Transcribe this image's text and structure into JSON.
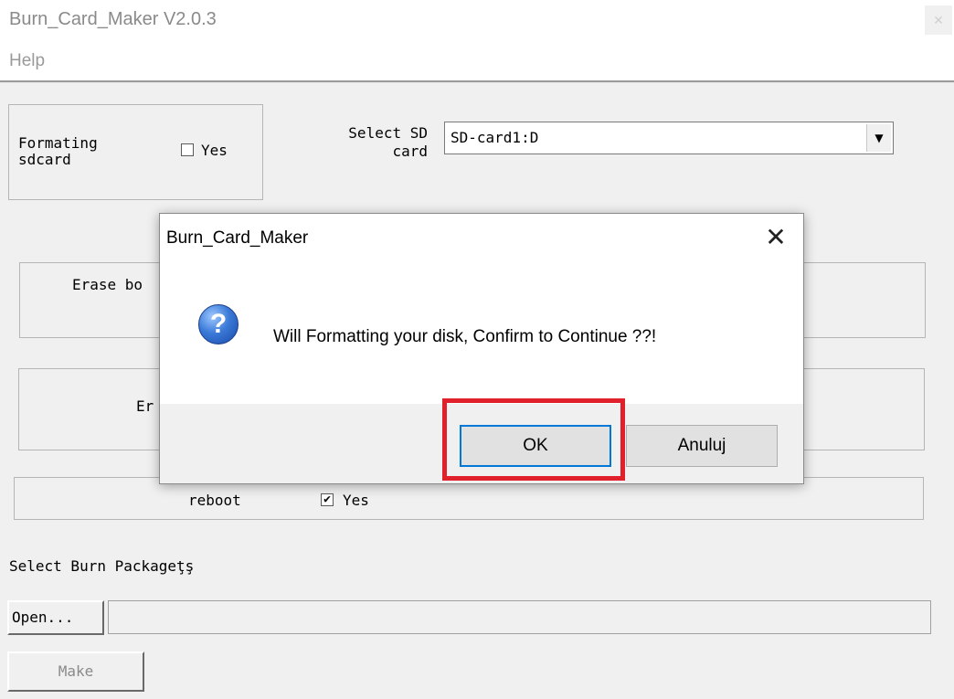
{
  "window": {
    "title": "Burn_Card_Maker V2.0.3",
    "close_icon": "close-icon"
  },
  "menu": {
    "help": "Help"
  },
  "format_group": {
    "label": "Formating\nsdcard",
    "checkbox_label": "Yes",
    "checked": false
  },
  "sd_select": {
    "label": "Select SD\ncard",
    "value": "SD-card1:D"
  },
  "erase_boot": {
    "label_partial": "Erase bo"
  },
  "erase_second": {
    "label_partial": "Er"
  },
  "reboot": {
    "label": "reboot",
    "checkbox_label": "Yes",
    "checked": true
  },
  "burn_packages": {
    "label": "Select Burn Packageţş",
    "open_button": "Open...",
    "path_value": ""
  },
  "make_button": "Make",
  "dialog": {
    "title": "Burn_Card_Maker",
    "close_glyph": "✕",
    "icon": "question-icon",
    "message": "Will Formatting your disk, Confirm to Continue ??!",
    "ok_label": "OK",
    "cancel_label": "Anuluj"
  },
  "annotation": {
    "highlight_color": "#e0202a"
  },
  "colors": {
    "window_bg": "#f0f0f0",
    "dialog_bg": "#ffffff",
    "accent": "#0078d7"
  }
}
